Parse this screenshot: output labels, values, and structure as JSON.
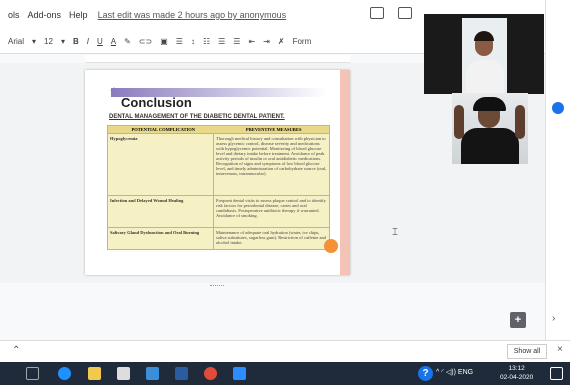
{
  "menubar": {
    "items": [
      "ols",
      "Add-ons",
      "Help"
    ],
    "last_edit": "Last edit was made 2 hours ago by anonymous"
  },
  "toolbar": {
    "font": "Arial",
    "font_size": "12",
    "bold": "B",
    "italic": "I",
    "underline": "U",
    "text_color": "A",
    "format": "Form"
  },
  "slide": {
    "title": "Conclusion",
    "subtitle": "DENTAL MANAGEMENT OF THE DIABETIC DENTAL PATIENT.",
    "table": {
      "headers": [
        "POTENTIAL COMPLICATION",
        "PREVENTIVE MEASURES"
      ],
      "rows": [
        {
          "complication": "Hypoglycemia",
          "measures": "Thorough medical history and consultation with physician to assess glycemic control, disease severity and medications with hypoglycemic potential. Monitoring of blood glucose level and dietary intake before treatment. Avoidance of peak activity periods of insulin or oral antidiabetic medications. Recognition of signs and symptoms of low blood glucose level, and timely administration of carbohydrate source (oral, intravenous, intramuscular)."
        },
        {
          "complication": "Infection and Delayed Wound Healing",
          "measures": "Frequent dental visits to assess plaque control and to identify risk factors for periodontal disease, caries and oral candidiasis. Postoperative antibiotic therapy if warranted. Avoidance of smoking."
        },
        {
          "complication": "Salivary Gland Dysfunction and Oral Burning",
          "measures": "Maintenance of adequate oral hydration (water, ice chips, saliva substitutes, sugarless gum). Restriction of caffeine and alcohol intake."
        }
      ]
    }
  },
  "bottom_bar": {
    "show_all": "Show all",
    "close": "×"
  },
  "taskbar": {
    "language": "ENG",
    "time": "13:12",
    "date": "02-04-2020"
  },
  "colors": {
    "taskbar": "#1f2a3a",
    "accent_orange": "#f39235",
    "table_bg": "#f6f1c5"
  }
}
